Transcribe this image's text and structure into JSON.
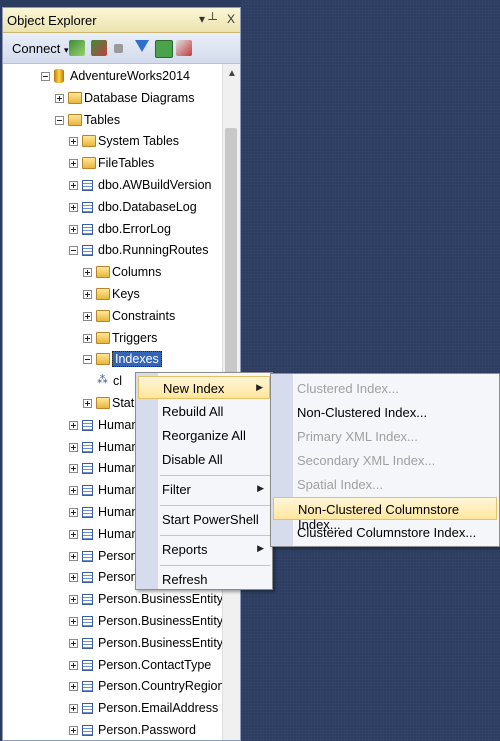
{
  "window": {
    "title": "Object Explorer",
    "pin_glyph": "▾ ┴",
    "close_glyph": "X"
  },
  "toolbar": {
    "connect_label": "Connect",
    "connect_arrow": "▾",
    "icons": [
      "connect-object-explorer-icon",
      "disconnect-icon",
      "stop-icon",
      "filter-icon",
      "refresh-icon",
      "summary-icon"
    ]
  },
  "tree": [
    {
      "label": "AdventureWorks2014",
      "icon": "database",
      "expander": "minus"
    },
    {
      "label": "Database Diagrams",
      "icon": "folder",
      "expander": "plus"
    },
    {
      "label": "Tables",
      "icon": "folder",
      "expander": "minus"
    },
    {
      "label": "System Tables",
      "icon": "folder",
      "expander": "plus"
    },
    {
      "label": "FileTables",
      "icon": "folder",
      "expander": "plus"
    },
    {
      "label": "dbo.AWBuildVersion",
      "icon": "table",
      "expander": "plus"
    },
    {
      "label": "dbo.DatabaseLog",
      "icon": "table",
      "expander": "plus"
    },
    {
      "label": "dbo.ErrorLog",
      "icon": "table",
      "expander": "plus"
    },
    {
      "label": "dbo.RunningRoutes",
      "icon": "table",
      "expander": "minus"
    },
    {
      "label": "Columns",
      "icon": "folder",
      "expander": "plus"
    },
    {
      "label": "Keys",
      "icon": "folder",
      "expander": "plus"
    },
    {
      "label": "Constraints",
      "icon": "folder",
      "expander": "plus"
    },
    {
      "label": "Triggers",
      "icon": "folder",
      "expander": "plus"
    },
    {
      "label": "Indexes",
      "icon": "folder",
      "expander": "minus",
      "selected": true
    },
    {
      "label": "cl",
      "icon": "index",
      "expander": "none"
    },
    {
      "label": "Stati",
      "icon": "folder",
      "expander": "plus"
    },
    {
      "label": "Human",
      "icon": "table",
      "expander": "plus"
    },
    {
      "label": "Human",
      "icon": "table",
      "expander": "plus"
    },
    {
      "label": "Human",
      "icon": "table",
      "expander": "plus"
    },
    {
      "label": "Human",
      "icon": "table",
      "expander": "plus"
    },
    {
      "label": "Human",
      "icon": "table",
      "expander": "plus"
    },
    {
      "label": "Human",
      "icon": "table",
      "expander": "plus"
    },
    {
      "label": "Person.",
      "icon": "table",
      "expander": "plus"
    },
    {
      "label": "Person.A",
      "icon": "table",
      "expander": "plus"
    },
    {
      "label": "Person.BusinessEntity",
      "icon": "table",
      "expander": "plus"
    },
    {
      "label": "Person.BusinessEntityAddr",
      "icon": "table",
      "expander": "plus"
    },
    {
      "label": "Person.BusinessEntityConta",
      "icon": "table",
      "expander": "plus"
    },
    {
      "label": "Person.ContactType",
      "icon": "table",
      "expander": "plus"
    },
    {
      "label": "Person.CountryRegion",
      "icon": "table",
      "expander": "plus"
    },
    {
      "label": "Person.EmailAddress",
      "icon": "table",
      "expander": "plus"
    },
    {
      "label": "Person.Password",
      "icon": "table",
      "expander": "plus"
    }
  ],
  "context_menu": {
    "items": [
      {
        "label": "New Index",
        "submenu": true,
        "highlighted": true
      },
      {
        "label": "Rebuild All"
      },
      {
        "label": "Reorganize All"
      },
      {
        "label": "Disable All"
      },
      {
        "separator": true
      },
      {
        "label": "Filter",
        "submenu": true
      },
      {
        "separator": true
      },
      {
        "label": "Start PowerShell"
      },
      {
        "separator": true
      },
      {
        "label": "Reports",
        "submenu": true
      },
      {
        "separator": true
      },
      {
        "label": "Refresh"
      }
    ]
  },
  "submenu": {
    "items": [
      {
        "label": "Clustered Index...",
        "disabled": true
      },
      {
        "label": "Non-Clustered Index..."
      },
      {
        "label": "Primary XML Index...",
        "disabled": true
      },
      {
        "label": "Secondary XML Index...",
        "disabled": true
      },
      {
        "label": "Spatial Index...",
        "disabled": true
      },
      {
        "label": "Non-Clustered Columnstore Index...",
        "highlighted": true
      },
      {
        "label": "Clustered Columnstore Index..."
      }
    ]
  }
}
